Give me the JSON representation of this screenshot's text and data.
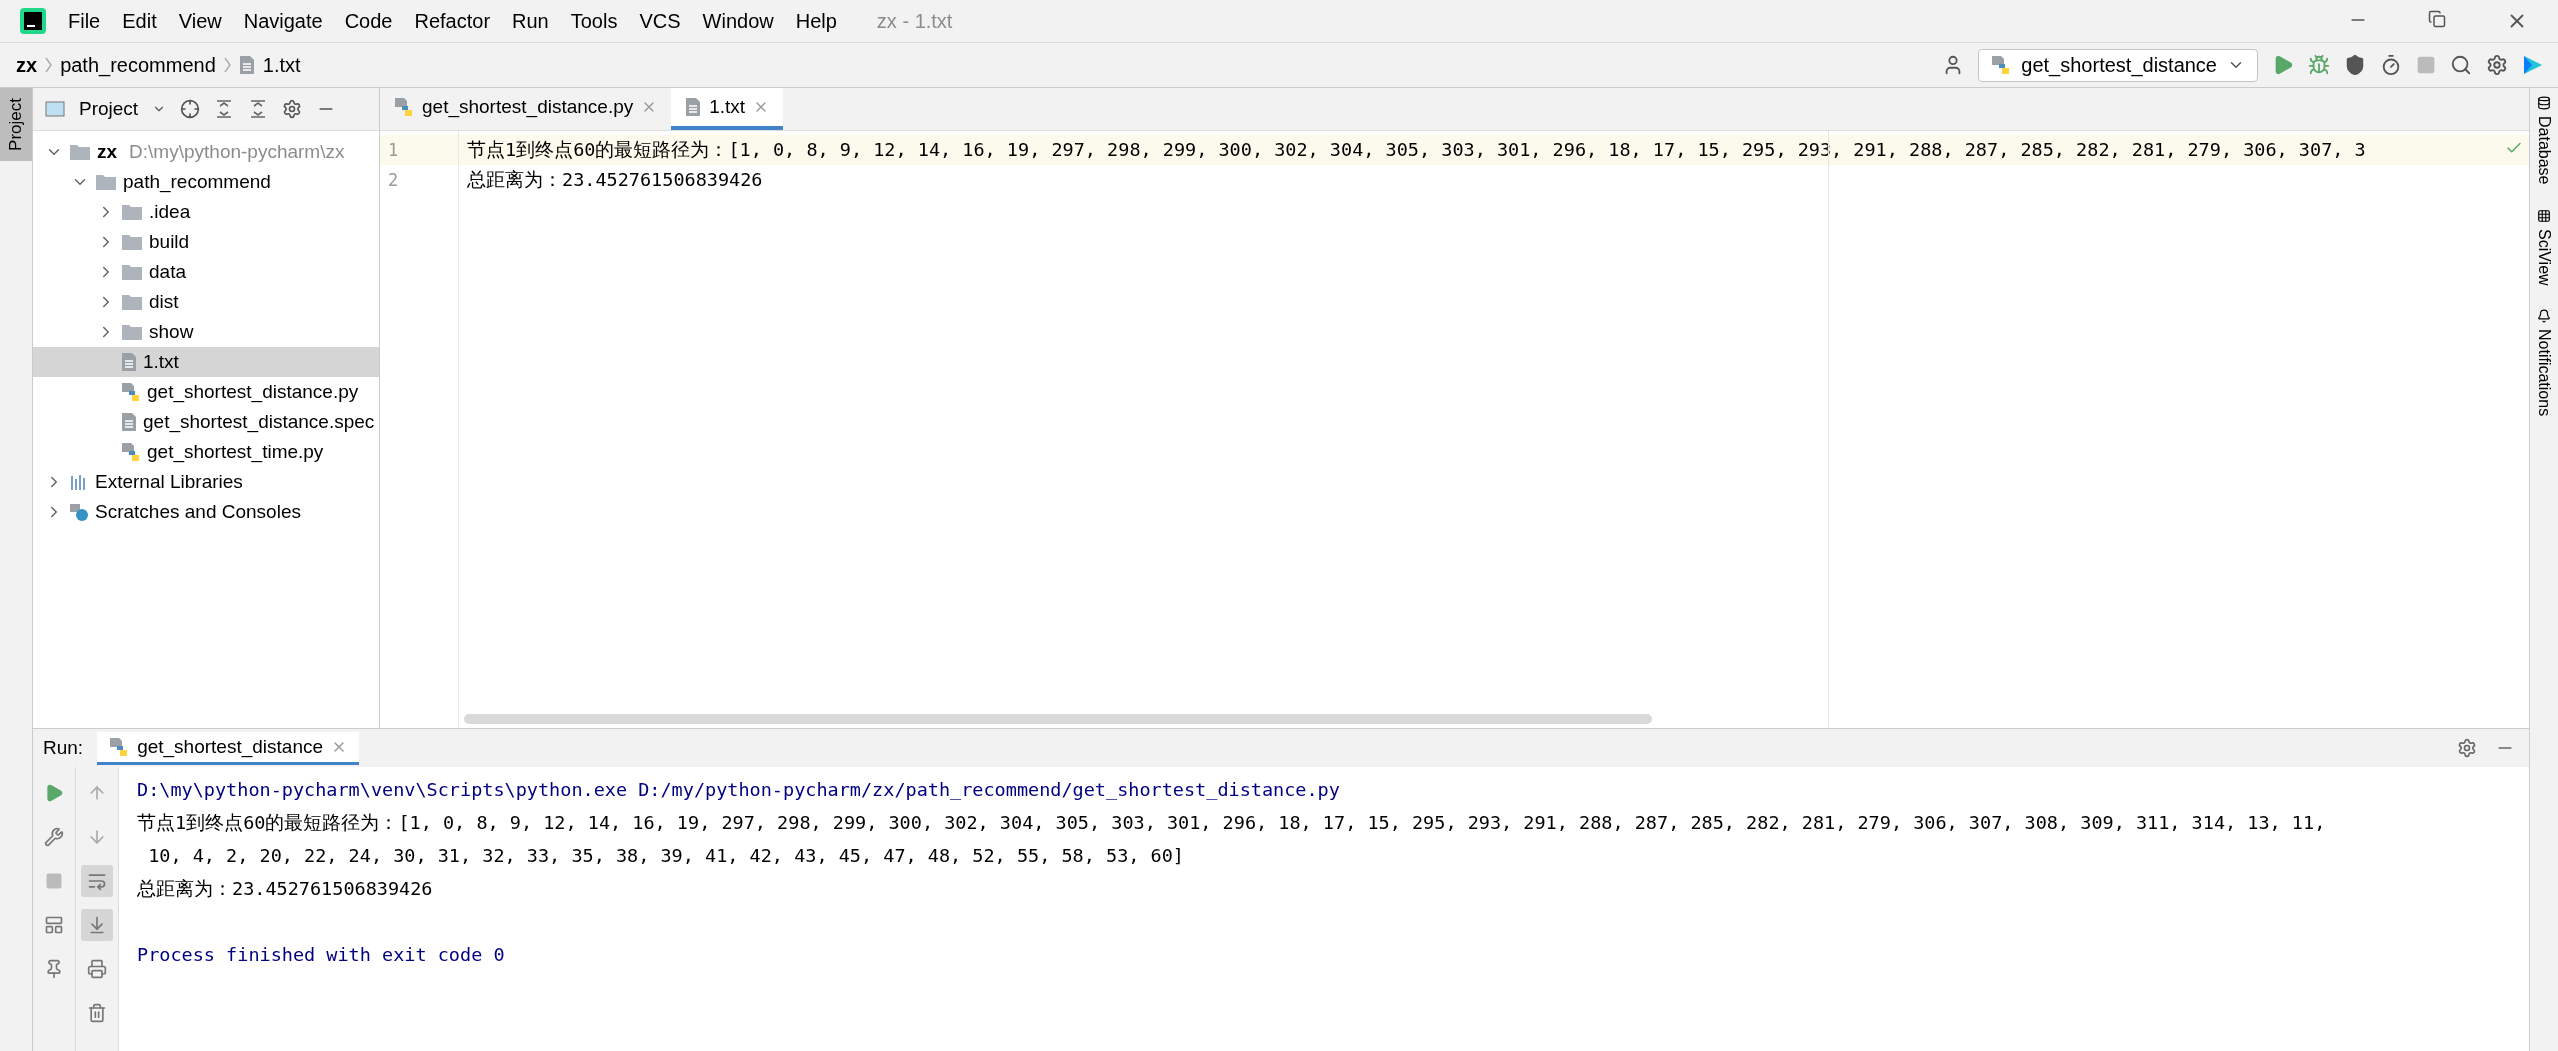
{
  "menu_bar": {
    "items": [
      "File",
      "Edit",
      "View",
      "Navigate",
      "Code",
      "Refactor",
      "Run",
      "Tools",
      "VCS",
      "Window",
      "Help"
    ],
    "title": "zx - 1.txt"
  },
  "breadcrumb": [
    {
      "label": "zx",
      "kind": "project"
    },
    {
      "label": "path_recommend",
      "kind": "folder"
    },
    {
      "label": "1.txt",
      "kind": "text"
    }
  ],
  "run_config": "get_shortest_distance",
  "left_tool_tabs": [
    {
      "label": "Project",
      "selected": true
    }
  ],
  "right_tool_tabs": [
    {
      "label": "Database",
      "kind": "database"
    },
    {
      "label": "SciView",
      "kind": "sciview"
    },
    {
      "label": "Notifications",
      "kind": "bell"
    }
  ],
  "project_panel": {
    "title": "Project",
    "tree": [
      {
        "name": "zx",
        "path": "D:\\my\\python-pycharm\\zx",
        "kind": "project",
        "expanded": true,
        "selected": false,
        "children": [
          {
            "name": "path_recommend",
            "kind": "folder",
            "expanded": true,
            "selected": false,
            "children": [
              {
                "name": ".idea",
                "kind": "folder",
                "expanded": false,
                "selected": false
              },
              {
                "name": "build",
                "kind": "folder",
                "expanded": false,
                "selected": false
              },
              {
                "name": "data",
                "kind": "folder",
                "expanded": false,
                "selected": false
              },
              {
                "name": "dist",
                "kind": "folder",
                "expanded": false,
                "selected": false
              },
              {
                "name": "show",
                "kind": "folder",
                "expanded": false,
                "selected": false
              },
              {
                "name": "1.txt",
                "kind": "text",
                "selected": true
              },
              {
                "name": "get_shortest_distance.py",
                "kind": "python",
                "selected": false
              },
              {
                "name": "get_shortest_distance.spec",
                "kind": "text",
                "selected": false
              },
              {
                "name": "get_shortest_time.py",
                "kind": "python",
                "selected": false
              }
            ]
          }
        ]
      },
      {
        "name": "External Libraries",
        "kind": "libraries",
        "expanded": false,
        "selected": false
      },
      {
        "name": "Scratches and Consoles",
        "kind": "scratches",
        "expanded": false,
        "selected": false
      }
    ]
  },
  "editor": {
    "tabs": [
      {
        "label": "get_shortest_distance.py",
        "kind": "python",
        "selected": false
      },
      {
        "label": "1.txt",
        "kind": "text",
        "selected": true
      }
    ],
    "lines": [
      {
        "number": "1",
        "text": "节点1到终点60的最短路径为：[1, 0, 8, 9, 12, 14, 16, 19, 297, 298, 299, 300, 302, 304, 305, 303, 301, 296, 18, 17, 15, 295, 293, 291, 288, 287, 285, 282, 281, 279, 306, 307, 3",
        "current": true
      },
      {
        "number": "2",
        "text": "总距离为：23.452761506839426",
        "current": false
      }
    ]
  },
  "run_panel": {
    "label": "Run:",
    "tab": "get_shortest_distance",
    "output": [
      {
        "kind": "command",
        "text": "D:\\my\\python-pycharm\\venv\\Scripts\\python.exe D:/my/python-pycharm/zx/path_recommend/get_shortest_distance.py"
      },
      {
        "kind": "stdout",
        "text": "节点1到终点60的最短路径为：[1, 0, 8, 9, 12, 14, 16, 19, 297, 298, 299, 300, 302, 304, 305, 303, 301, 296, 18, 17, 15, 295, 293, 291, 288, 287, 285, 282, 281, 279, 306, 307, 308, 309, 311, 314, 13, 11,"
      },
      {
        "kind": "stdout",
        "text": " 10, 4, 2, 20, 22, 24, 30, 31, 32, 33, 35, 38, 39, 41, 42, 43, 45, 47, 48, 52, 55, 58, 53, 60]"
      },
      {
        "kind": "stdout",
        "text": "总距离为：23.452761506839426"
      },
      {
        "kind": "system",
        "text": "Process finished with exit code 0"
      }
    ]
  }
}
